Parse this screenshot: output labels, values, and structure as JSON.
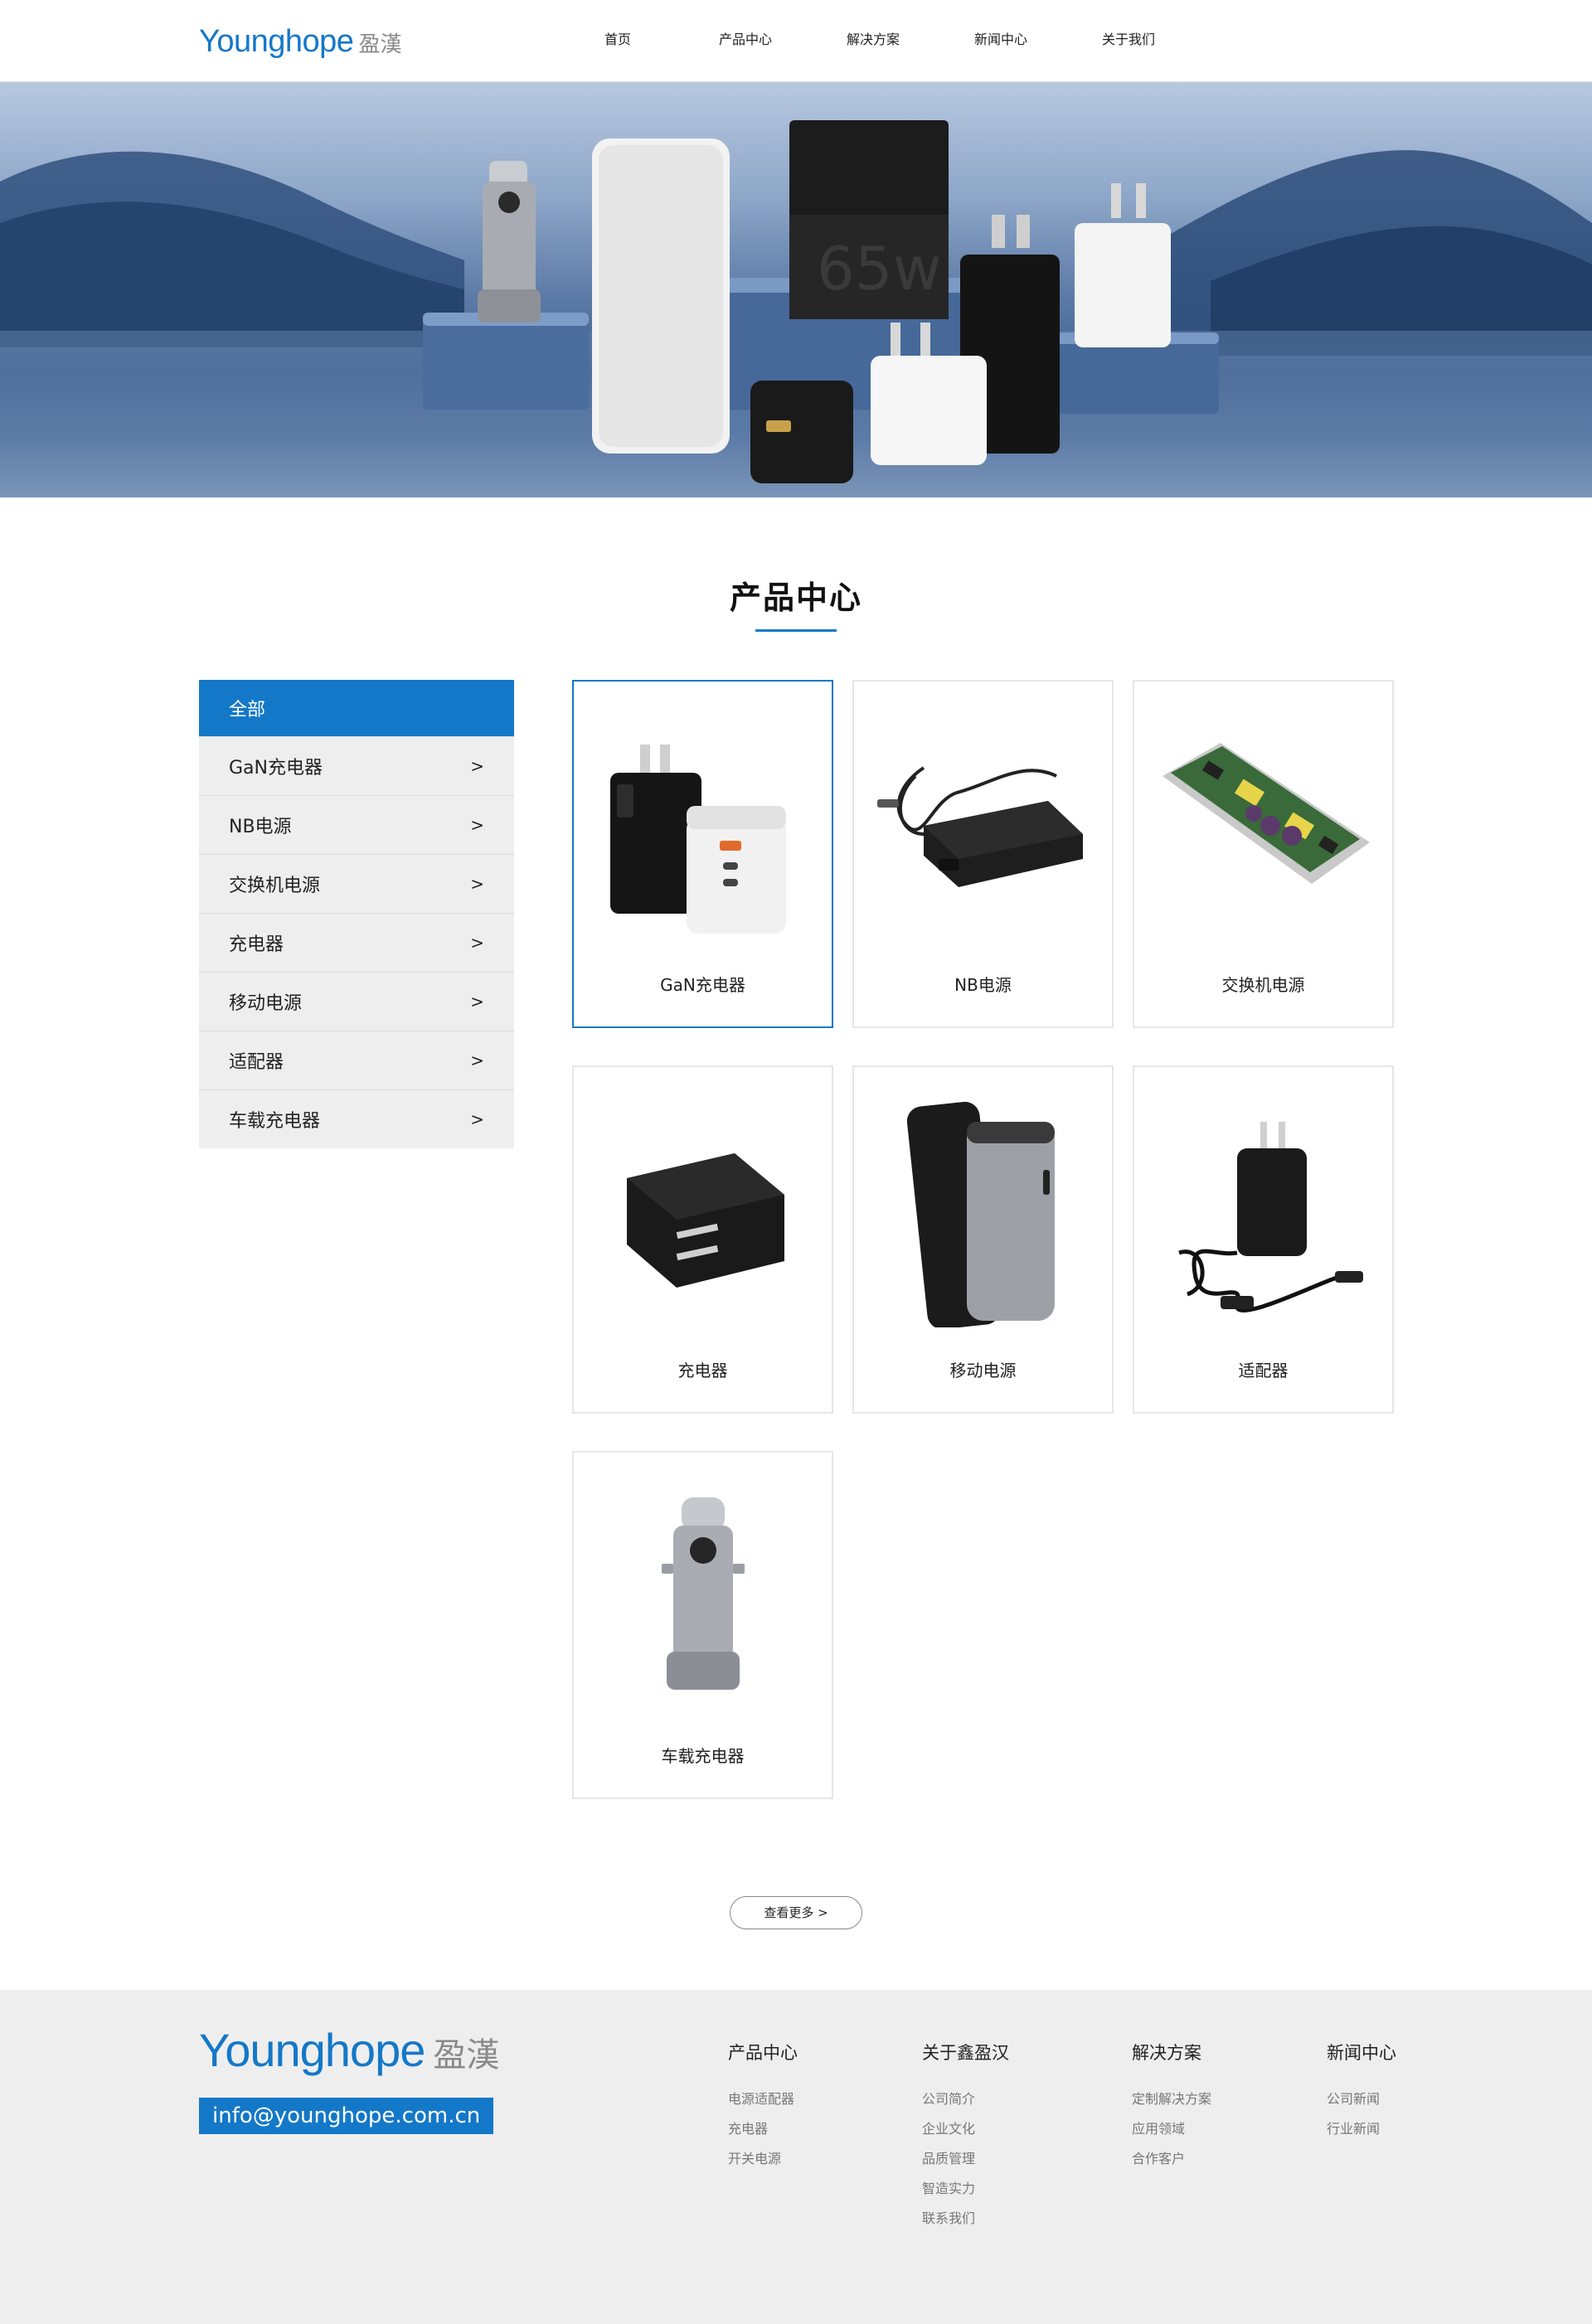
{
  "header": {
    "logo_en": "Younghope",
    "logo_cn": "盈漢",
    "nav": [
      "首页",
      "产品中心",
      "解决方案",
      "新闻中心",
      "关于我们"
    ]
  },
  "section": {
    "title": "产品中心"
  },
  "sidebar": {
    "items": [
      {
        "label": "全部",
        "arrow": ""
      },
      {
        "label": "GaN充电器",
        "arrow": ">"
      },
      {
        "label": "NB电源",
        "arrow": ">"
      },
      {
        "label": "交换机电源",
        "arrow": ">"
      },
      {
        "label": "充电器",
        "arrow": ">"
      },
      {
        "label": "移动电源",
        "arrow": ">"
      },
      {
        "label": "适配器",
        "arrow": ">"
      },
      {
        "label": "车载充电器",
        "arrow": ">"
      }
    ]
  },
  "products": [
    {
      "label": "GaN充电器"
    },
    {
      "label": "NB电源"
    },
    {
      "label": "交换机电源"
    },
    {
      "label": "充电器"
    },
    {
      "label": "移动电源"
    },
    {
      "label": "适配器"
    },
    {
      "label": "车载充电器"
    }
  ],
  "more_button": "查看更多 >",
  "footer": {
    "logo_en": "Younghope",
    "logo_cn": "盈漢",
    "email": "info@younghope.com.cn",
    "columns": [
      {
        "title": "产品中心",
        "links": [
          "电源适配器",
          "充电器",
          "开关电源"
        ]
      },
      {
        "title": "关于鑫盈汉",
        "links": [
          "公司简介",
          "企业文化",
          "品质管理",
          "智造实力",
          "联系我们"
        ]
      },
      {
        "title": "解决方案",
        "links": [
          "定制解决方案",
          "应用领域",
          "合作客户"
        ]
      },
      {
        "title": "新闻中心",
        "links": [
          "公司新闻",
          "行业新闻"
        ]
      }
    ]
  },
  "colors": {
    "accent": "#1478c8",
    "sidebar_bg": "#eeeeee",
    "footer_bg": "#eeeeee"
  },
  "banner": {
    "charger_text": "65w"
  }
}
